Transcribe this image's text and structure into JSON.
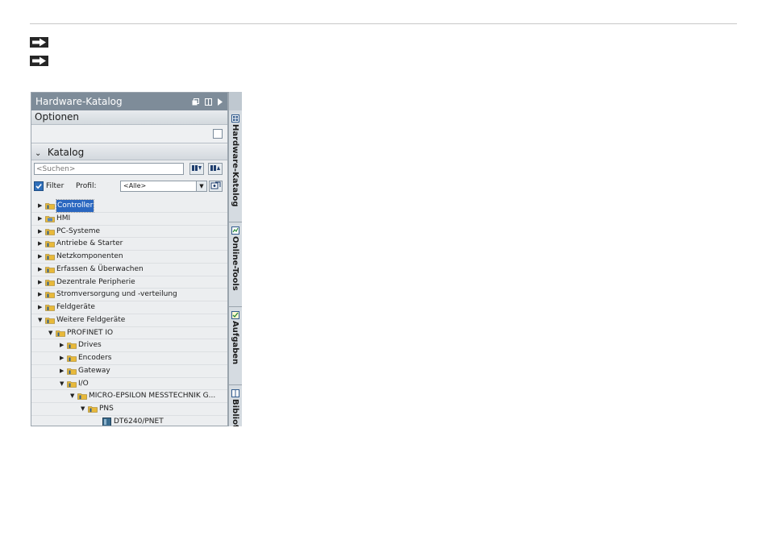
{
  "panel": {
    "title": "Hardware-Katalog",
    "optionen_label": "Optionen",
    "katalog_label": "Katalog",
    "search_placeholder": "<Suchen>",
    "filter_label": "Filter",
    "profil_label": "Profil:",
    "profil_value": "<Alle>"
  },
  "tree": [
    {
      "label": "Controller",
      "level": 0,
      "expanded": false,
      "selected": true,
      "icon": "folder-icon"
    },
    {
      "label": "HMI",
      "level": 0,
      "expanded": false,
      "selected": false,
      "icon": "hmi-folder-icon"
    },
    {
      "label": "PC-Systeme",
      "level": 0,
      "expanded": false,
      "selected": false,
      "icon": "folder-icon"
    },
    {
      "label": "Antriebe & Starter",
      "level": 0,
      "expanded": false,
      "selected": false,
      "icon": "folder-icon"
    },
    {
      "label": "Netzkomponenten",
      "level": 0,
      "expanded": false,
      "selected": false,
      "icon": "folder-icon"
    },
    {
      "label": "Erfassen & Überwachen",
      "level": 0,
      "expanded": false,
      "selected": false,
      "icon": "folder-icon"
    },
    {
      "label": "Dezentrale Peripherie",
      "level": 0,
      "expanded": false,
      "selected": false,
      "icon": "folder-icon"
    },
    {
      "label": "Stromversorgung und -verteilung",
      "level": 0,
      "expanded": false,
      "selected": false,
      "icon": "folder-icon"
    },
    {
      "label": "Feldgeräte",
      "level": 0,
      "expanded": false,
      "selected": false,
      "icon": "folder-icon"
    },
    {
      "label": "Weitere Feldgeräte",
      "level": 0,
      "expanded": true,
      "selected": false,
      "icon": "folder-icon"
    },
    {
      "label": "PROFINET IO",
      "level": 1,
      "expanded": true,
      "selected": false,
      "icon": "folder-icon"
    },
    {
      "label": "Drives",
      "level": 2,
      "expanded": false,
      "selected": false,
      "icon": "folder-icon"
    },
    {
      "label": "Encoders",
      "level": 2,
      "expanded": false,
      "selected": false,
      "icon": "folder-icon"
    },
    {
      "label": "Gateway",
      "level": 2,
      "expanded": false,
      "selected": false,
      "icon": "folder-icon"
    },
    {
      "label": "I/O",
      "level": 2,
      "expanded": true,
      "selected": false,
      "icon": "folder-icon"
    },
    {
      "label": "MICRO-EPSILON MESSTECHNIK G...",
      "level": 3,
      "expanded": true,
      "selected": false,
      "icon": "folder-icon"
    },
    {
      "label": "PNS",
      "level": 4,
      "expanded": true,
      "selected": false,
      "icon": "folder-icon"
    },
    {
      "label": "DT6240/PNET",
      "level": 5,
      "expanded": null,
      "selected": false,
      "icon": "device-icon"
    },
    {
      "label": "",
      "level": 5,
      "expanded": null,
      "selected": false,
      "icon": "device-icon"
    }
  ],
  "side_tabs": [
    {
      "label": "Hardware-Katalog",
      "icon": "catalog-icon"
    },
    {
      "label": "Online-Tools",
      "icon": "online-tools-icon"
    },
    {
      "label": "Aufgaben",
      "icon": "tasks-icon"
    },
    {
      "label": "Bibliot",
      "icon": "library-icon"
    }
  ],
  "colors": {
    "title_bar": "#7e8c99",
    "selection": "#2a67c0",
    "folder": "#e8b93a"
  }
}
